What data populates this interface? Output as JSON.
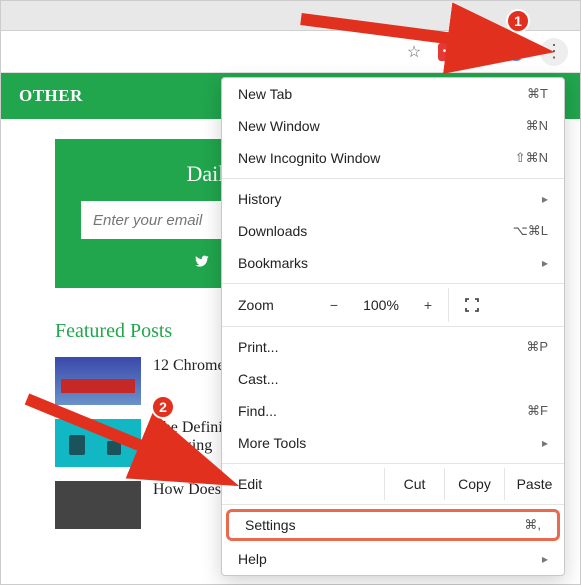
{
  "nav": {
    "other": "OTHER"
  },
  "signup": {
    "title": "Daily Email",
    "placeholder": "Enter your email"
  },
  "featured": {
    "heading": "Featured Posts",
    "posts": [
      {
        "title": "12 Chrome"
      },
      {
        "title": "The Defini\nCharging"
      },
      {
        "title": "How Does Wireless Charging"
      }
    ]
  },
  "menu": {
    "new_tab": {
      "label": "New Tab",
      "shortcut": "⌘T"
    },
    "new_window": {
      "label": "New Window",
      "shortcut": "⌘N"
    },
    "new_incognito": {
      "label": "New Incognito Window",
      "shortcut": "⇧⌘N"
    },
    "history": {
      "label": "History"
    },
    "downloads": {
      "label": "Downloads",
      "shortcut": "⌥⌘L"
    },
    "bookmarks": {
      "label": "Bookmarks"
    },
    "zoom": {
      "label": "Zoom",
      "value": "100%"
    },
    "print": {
      "label": "Print...",
      "shortcut": "⌘P"
    },
    "cast": {
      "label": "Cast..."
    },
    "find": {
      "label": "Find...",
      "shortcut": "⌘F"
    },
    "more_tools": {
      "label": "More Tools"
    },
    "edit": {
      "label": "Edit",
      "cut": "Cut",
      "copy": "Copy",
      "paste": "Paste"
    },
    "settings": {
      "label": "Settings",
      "shortcut": "⌘,"
    },
    "help": {
      "label": "Help"
    }
  },
  "annotations": {
    "badge1": "1",
    "badge2": "2"
  }
}
